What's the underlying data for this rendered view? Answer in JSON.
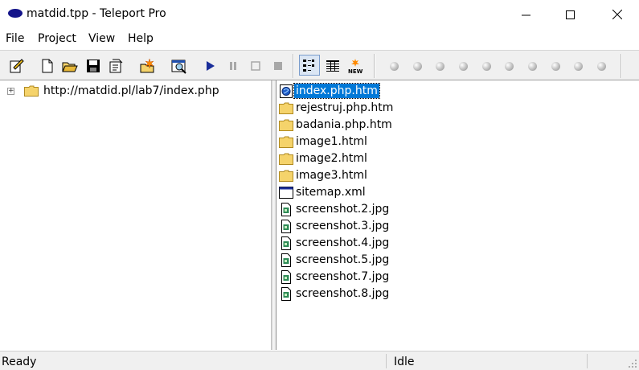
{
  "window": {
    "title": "matdid.tpp - Teleport Pro"
  },
  "menu": [
    "File",
    "Project",
    "View",
    "Help"
  ],
  "toolbar": {
    "icons": [
      "new-project-wizard-icon",
      "new-icon",
      "open-icon",
      "save-icon",
      "properties-icon",
      "clear-icon",
      "browse-icon",
      "start-icon",
      "pause-icon",
      "stop-icon",
      "stop-all-icon",
      "list-view-icon",
      "details-view-icon",
      "new-only-icon"
    ]
  },
  "tree": {
    "root_label": "http://matdid.pl/lab7/index.php"
  },
  "files": [
    {
      "name": "index.php.htm",
      "type": "page",
      "selected": true
    },
    {
      "name": "rejestruj.php.htm",
      "type": "folder"
    },
    {
      "name": "badania.php.htm",
      "type": "folder"
    },
    {
      "name": "image1.html",
      "type": "folder"
    },
    {
      "name": "image2.html",
      "type": "folder"
    },
    {
      "name": "image3.html",
      "type": "folder"
    },
    {
      "name": "sitemap.xml",
      "type": "xml"
    },
    {
      "name": "screenshot.2.jpg",
      "type": "image"
    },
    {
      "name": "screenshot.3.jpg",
      "type": "image"
    },
    {
      "name": "screenshot.4.jpg",
      "type": "image"
    },
    {
      "name": "screenshot.5.jpg",
      "type": "image"
    },
    {
      "name": "screenshot.7.jpg",
      "type": "image"
    },
    {
      "name": "screenshot.8.jpg",
      "type": "image"
    }
  ],
  "status": {
    "left": "Ready",
    "middle": "Idle"
  },
  "colors": {
    "selection": "#0078d7",
    "folder": "#f5d36b",
    "app_icon": "#14148a"
  }
}
